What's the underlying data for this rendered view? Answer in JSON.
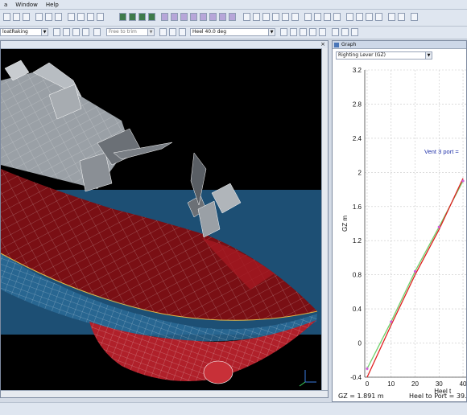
{
  "menubar": {
    "items": [
      "a",
      "Window",
      "Help"
    ]
  },
  "toolbar": {
    "load_case_combo": "loatRaking",
    "free_to_trim_combo": "Free to trim",
    "heel_combo": "Heel 40.0 deg"
  },
  "viewport": {
    "close_label": "×"
  },
  "graph_window": {
    "title": "Graph",
    "type_combo": "Righting Lever (GZ)",
    "annotation": "Vent 3 port =",
    "chart_data": {
      "type": "line",
      "ylabel": "GZ  m",
      "xlabel": "Heel t",
      "xlim": [
        -1,
        42
      ],
      "ylim": [
        -0.4,
        3.2
      ],
      "x_ticks": [
        "0",
        "10",
        "20",
        "30",
        "40"
      ],
      "y_ticks": [
        "-0.4",
        "0",
        "0.4",
        "0.8",
        "1.2",
        "1.6",
        "2",
        "2.4",
        "2.8",
        "3.2"
      ],
      "series": [
        {
          "x": [
            0,
            10,
            20,
            30,
            40
          ],
          "values": [
            -0.3,
            0.25,
            0.84,
            1.36,
            1.9
          ],
          "color": "#6ed06a"
        },
        {
          "x": [
            0,
            10,
            20,
            30,
            40
          ],
          "values": [
            -0.4,
            0.21,
            0.8,
            1.33,
            1.93
          ],
          "color": "#e02020"
        }
      ],
      "point_color": "#d060d8",
      "grid": true
    }
  },
  "readouts": {
    "gz": "GZ = 1.891 m",
    "heel_to_port": "Heel to Port = 39."
  }
}
